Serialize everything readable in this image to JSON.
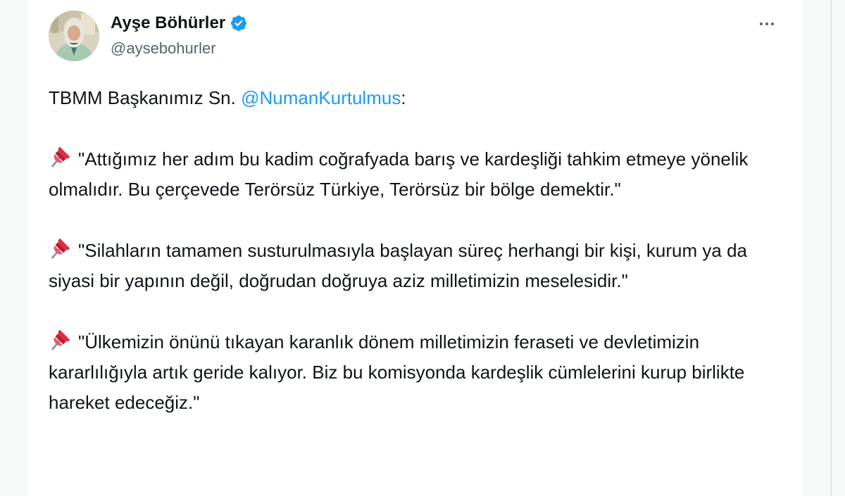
{
  "author": {
    "display_name": "Ayşe Böhürler",
    "handle": "@aysebohurler",
    "verified": true
  },
  "tweet": {
    "intro_prefix": "TBMM Başkanımız Sn. ",
    "mention": "@NumanKurtulmus",
    "intro_suffix": ":",
    "quotes": [
      {
        "icon": "pushpin-icon",
        "text": "\"Attığımız her adım bu kadim coğrafyada barış ve kardeşliği tahkim etmeye yönelik olmalıdır. Bu çerçevede Terörsüz Türkiye, Terörsüz bir bölge demektir.\""
      },
      {
        "icon": "pushpin-icon",
        "text": "\"Silahların tamamen susturulmasıyla başlayan süreç herhangi bir kişi, kurum ya da siyasi bir yapının değil, doğrudan doğruya aziz milletimizin meselesidir.\""
      },
      {
        "icon": "pushpin-icon",
        "text": "\"Ülkemizin önünü tıkayan karanlık dönem milletimizin feraseti ve devletimizin kararlılığıyla artık geride kalıyor. Biz bu komisyonda kardeşlik cümlelerini kurup birlikte hareket edeceğiz.\""
      }
    ]
  },
  "colors": {
    "text": "#0f1419",
    "secondary": "#536471",
    "accent": "#1d9bf0",
    "pin_red": "#e0245e"
  }
}
